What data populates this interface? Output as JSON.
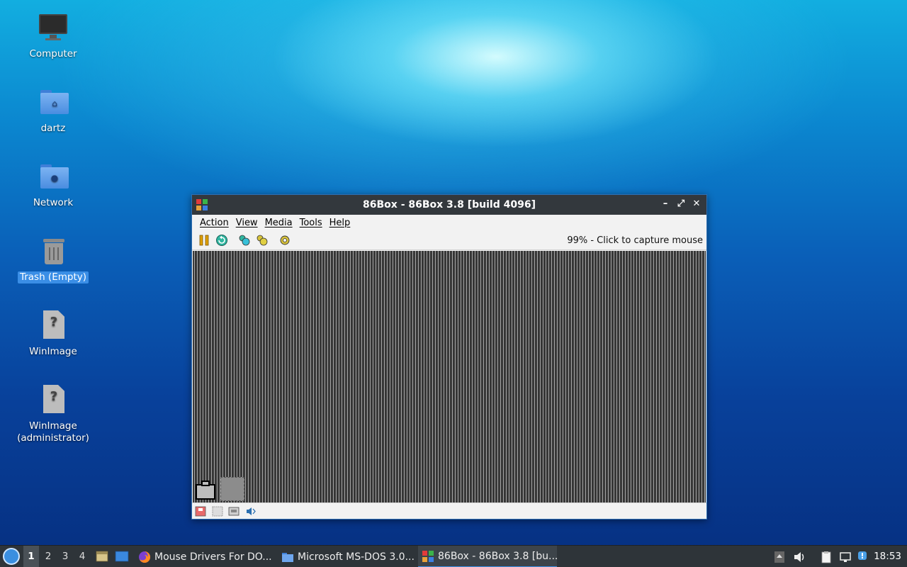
{
  "desktop": {
    "icons": [
      {
        "label": "Computer"
      },
      {
        "label": "dartz"
      },
      {
        "label": "Network"
      },
      {
        "label": "Trash (Empty)"
      },
      {
        "label": "WinImage"
      },
      {
        "label": "WinImage\n(administrator)"
      }
    ]
  },
  "window": {
    "title": "86Box - 86Box 3.8 [build 4096]",
    "controls": {
      "minimize": "–",
      "maximize": "⤢",
      "close": "✕"
    },
    "menu": [
      "Action",
      "View",
      "Media",
      "Tools",
      "Help"
    ],
    "status_text": "99% - Click to capture mouse"
  },
  "taskbar": {
    "workspaces": [
      "1",
      "2",
      "3",
      "4"
    ],
    "active_workspace": "1",
    "tasks": [
      {
        "label": "Mouse Drivers For DO..."
      },
      {
        "label": "Microsoft MS-DOS 3.0..."
      },
      {
        "label": "86Box - 86Box 3.8 [bu..."
      }
    ],
    "clock": "18:53"
  },
  "colors": {
    "selection": "#3a8ee6",
    "titlebar": "#33383d",
    "taskbar": "#2e3439",
    "task_active_underline": "#3c8fe5"
  }
}
